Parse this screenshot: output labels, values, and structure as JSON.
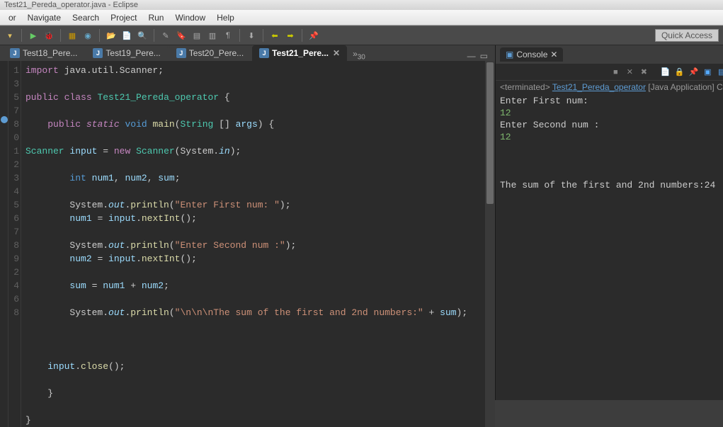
{
  "window_title": "Test21_Pereda_operator.java - Eclipse",
  "menu": [
    "or",
    "Navigate",
    "Search",
    "Project",
    "Run",
    "Window",
    "Help"
  ],
  "quick_access": "Quick Access",
  "tabs": [
    {
      "label": "Test18_Pere...",
      "active": false
    },
    {
      "label": "Test19_Pere...",
      "active": false
    },
    {
      "label": "Test20_Pere...",
      "active": false
    },
    {
      "label": "Test21_Pere...",
      "active": true
    }
  ],
  "gutter_lines": [
    "1",
    "",
    "3",
    "",
    "5",
    "",
    "7",
    "8",
    "",
    "0",
    "1",
    "2",
    "3",
    "4",
    "5",
    "6",
    "7",
    "8",
    "9",
    "",
    "",
    "2",
    "",
    "4",
    "",
    "6",
    "",
    "8"
  ],
  "code_tokens": [
    [
      {
        "c": "kw-import",
        "t": "import"
      },
      {
        "t": " java.util.Scanner;"
      }
    ],
    [],
    [
      {
        "c": "kw-mod",
        "t": "public"
      },
      {
        "t": " "
      },
      {
        "c": "kw-mod",
        "t": "class"
      },
      {
        "t": " "
      },
      {
        "c": "kw-class",
        "t": "Test21_Pereda_operator"
      },
      {
        "t": " {"
      }
    ],
    [],
    [
      {
        "t": "    "
      },
      {
        "c": "kw-mod",
        "t": "public"
      },
      {
        "t": " "
      },
      {
        "c": "kw-static",
        "t": "static"
      },
      {
        "t": " "
      },
      {
        "c": "kw-type",
        "t": "void"
      },
      {
        "t": " "
      },
      {
        "c": "method",
        "t": "main"
      },
      {
        "t": "("
      },
      {
        "c": "kw-class",
        "t": "String"
      },
      {
        "t": " [] "
      },
      {
        "c": "var-name",
        "t": "args"
      },
      {
        "t": ") {"
      }
    ],
    [],
    [
      {
        "c": "kw-class",
        "t": "Scanner"
      },
      {
        "t": " "
      },
      {
        "c": "var-name",
        "t": "input"
      },
      {
        "t": " = "
      },
      {
        "c": "kw-new",
        "t": "new"
      },
      {
        "t": " "
      },
      {
        "c": "kw-class",
        "t": "Scanner"
      },
      {
        "t": "(System."
      },
      {
        "c": "fld-italic",
        "t": "in"
      },
      {
        "t": ");"
      }
    ],
    [],
    [
      {
        "t": "        "
      },
      {
        "c": "kw-type",
        "t": "int"
      },
      {
        "t": " "
      },
      {
        "c": "var-name",
        "t": "num1"
      },
      {
        "t": ", "
      },
      {
        "c": "var-name",
        "t": "num2"
      },
      {
        "t": ", "
      },
      {
        "c": "var-name",
        "t": "sum"
      },
      {
        "t": ";"
      }
    ],
    [],
    [
      {
        "t": "        System."
      },
      {
        "c": "fld-italic",
        "t": "out"
      },
      {
        "t": "."
      },
      {
        "c": "method",
        "t": "println"
      },
      {
        "t": "("
      },
      {
        "c": "str",
        "t": "\"Enter First num: \""
      },
      {
        "t": ");"
      }
    ],
    [
      {
        "t": "        "
      },
      {
        "c": "var-name",
        "t": "num1"
      },
      {
        "t": " = "
      },
      {
        "c": "var-name",
        "t": "input"
      },
      {
        "t": "."
      },
      {
        "c": "method",
        "t": "nextInt"
      },
      {
        "t": "();"
      }
    ],
    [],
    [
      {
        "t": "        System."
      },
      {
        "c": "fld-italic",
        "t": "out"
      },
      {
        "t": "."
      },
      {
        "c": "method",
        "t": "println"
      },
      {
        "t": "("
      },
      {
        "c": "str",
        "t": "\"Enter Second num :\""
      },
      {
        "t": ");"
      }
    ],
    [
      {
        "t": "        "
      },
      {
        "c": "var-name",
        "t": "num2"
      },
      {
        "t": " = "
      },
      {
        "c": "var-name",
        "t": "input"
      },
      {
        "t": "."
      },
      {
        "c": "method",
        "t": "nextInt"
      },
      {
        "t": "();"
      }
    ],
    [],
    [
      {
        "t": "        "
      },
      {
        "c": "var-name",
        "t": "sum"
      },
      {
        "t": " = "
      },
      {
        "c": "var-name",
        "t": "num1"
      },
      {
        "t": " + "
      },
      {
        "c": "var-name",
        "t": "num2"
      },
      {
        "t": ";"
      }
    ],
    [],
    [
      {
        "t": "        System."
      },
      {
        "c": "fld-italic",
        "t": "out"
      },
      {
        "t": "."
      },
      {
        "c": "method",
        "t": "println"
      },
      {
        "t": "("
      },
      {
        "c": "str",
        "t": "\"\\n\\n\\nThe sum of the first and 2nd numbers:\""
      },
      {
        "t": " + "
      },
      {
        "c": "var-name",
        "t": "sum"
      },
      {
        "t": ");"
      }
    ],
    [],
    [],
    [],
    [
      {
        "t": "    "
      },
      {
        "c": "var-name",
        "t": "input"
      },
      {
        "t": "."
      },
      {
        "c": "method",
        "t": "close"
      },
      {
        "t": "();"
      }
    ],
    [],
    [
      {
        "t": "    }"
      }
    ],
    [],
    [
      {
        "t": "}"
      }
    ]
  ],
  "console": {
    "tab_label": "Console",
    "status_prefix": "<terminated>",
    "status_link": "Test21_Pereda_operator",
    "status_suffix": " [Java Application] C:\\",
    "output": [
      {
        "t": "Enter First num: ",
        "c": ""
      },
      {
        "t": "12",
        "c": "input-echo"
      },
      {
        "t": "Enter Second num :",
        "c": ""
      },
      {
        "t": "12",
        "c": "input-echo"
      },
      {
        "t": "",
        "c": ""
      },
      {
        "t": "",
        "c": ""
      },
      {
        "t": "",
        "c": ""
      },
      {
        "t": "The sum of the first and 2nd numbers:24",
        "c": ""
      }
    ]
  }
}
